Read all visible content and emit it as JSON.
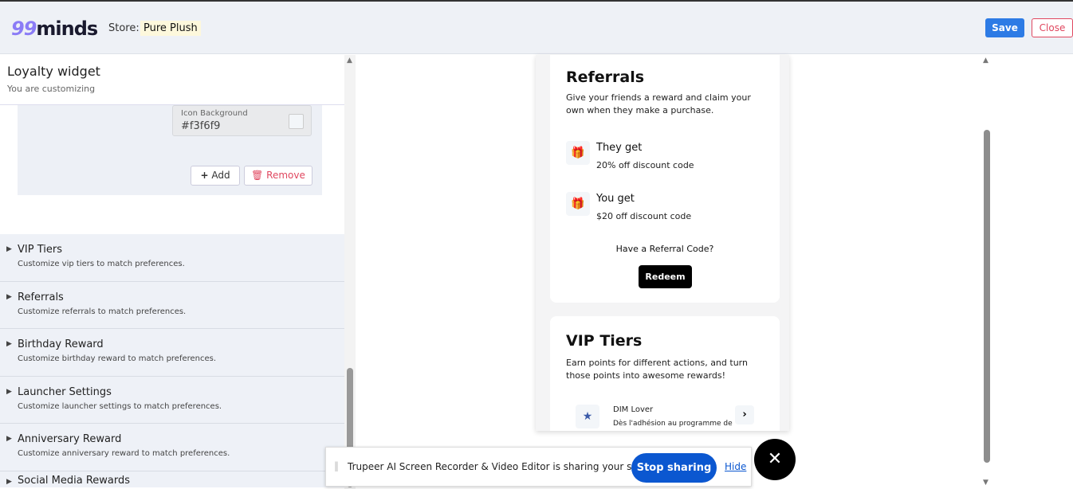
{
  "header": {
    "logo_prefix": "99",
    "logo_text": "minds",
    "store_label": "Store:",
    "store_name": "Pure Plush",
    "save": "Save",
    "close": "Close"
  },
  "left": {
    "title": "Loyalty widget",
    "subtitle": "You are customizing",
    "field": {
      "label": "Icon Background",
      "value": "#f3f6f9"
    },
    "add": "Add",
    "remove": "Remove",
    "sections": [
      {
        "title": "VIP Tiers",
        "desc": "Customize vip tiers to match preferences."
      },
      {
        "title": "Referrals",
        "desc": "Customize referrals to match preferences."
      },
      {
        "title": "Birthday Reward",
        "desc": "Customize birthday reward to match preferences."
      },
      {
        "title": "Launcher Settings",
        "desc": "Customize launcher settings to match preferences."
      },
      {
        "title": "Anniversary Reward",
        "desc": "Customize anniversary reward to match preferences."
      },
      {
        "title": "Social Media Rewards",
        "desc": ""
      }
    ]
  },
  "preview": {
    "referrals": {
      "title": "Referrals",
      "desc": "Give your friends a reward and claim your own when they make a purchase.",
      "they_title": "They get",
      "they_desc": "20% off discount code",
      "you_title": "You get",
      "you_desc": "$20 off discount code",
      "have_code": "Have a Referral Code?",
      "redeem": "Redeem"
    },
    "vip": {
      "title": "VIP Tiers",
      "desc": "Earn points for different actions, and turn those points into awesome rewards!",
      "tier_name": "DIM Lover",
      "tier_desc": "Dès l'adhésion au programme de"
    }
  },
  "share_bar": {
    "message": "Trupeer AI Screen Recorder & Video Editor is sharing your screen.",
    "stop": "Stop sharing",
    "hide": "Hide"
  },
  "colors": {
    "primary": "#2d7be5",
    "danger": "#e0475f",
    "gift": "#2ecc8a",
    "chrome_blue": "#0b57d0"
  }
}
